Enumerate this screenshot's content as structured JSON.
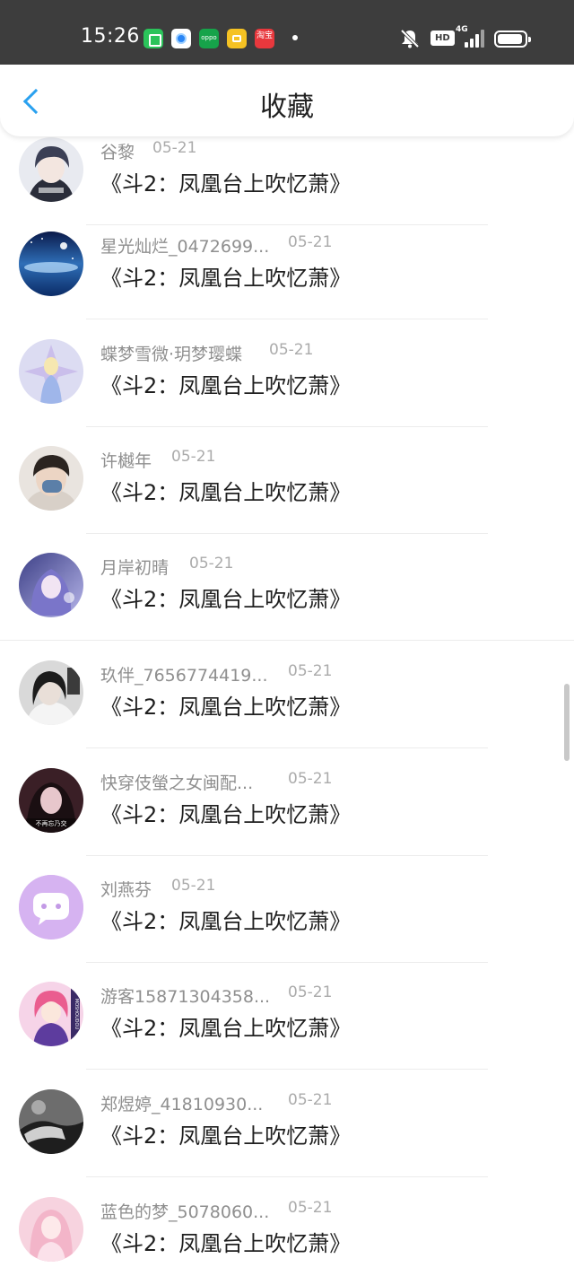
{
  "status_bar": {
    "time": "15:26",
    "apps": [
      "wechat-style-app",
      "circle-app",
      "oppo",
      "diamond-app",
      "淘宝"
    ],
    "oppo_label": "oppo",
    "taobao_label": "淘宝",
    "hd": "HD",
    "network": "4G"
  },
  "header": {
    "title": "收藏",
    "back_icon": "chevron-left-icon",
    "accent": "#2aa1ef"
  },
  "items": [
    {
      "name": "谷黎",
      "date": "05-21",
      "title": "《斗2：凤凰台上吹忆萧》"
    },
    {
      "name": "星光灿烂_0472699...",
      "date": "05-21",
      "title": "《斗2：凤凰台上吹忆萧》"
    },
    {
      "name": "蝶梦雪微·玥梦璎蝶",
      "date": "05-21",
      "title": "《斗2：凤凰台上吹忆萧》"
    },
    {
      "name": "许樾年",
      "date": "05-21",
      "title": "《斗2：凤凰台上吹忆萧》"
    },
    {
      "name": "月岸初晴",
      "date": "05-21",
      "title": "《斗2：凤凰台上吹忆萧》"
    },
    {
      "name": "玖伴_7656774419...",
      "date": "05-21",
      "title": "《斗2：凤凰台上吹忆萧》"
    },
    {
      "name": "快穿伎螢之女闽配...",
      "date": "05-21",
      "title": "《斗2：凤凰台上吹忆萧》"
    },
    {
      "name": "刘燕芬",
      "date": "05-21",
      "title": "《斗2：凤凰台上吹忆萧》"
    },
    {
      "name": "游客15871304358...",
      "date": "05-21",
      "title": "《斗2：凤凰台上吹忆萧》"
    },
    {
      "name": "郑煜婷_41810930...",
      "date": "05-21",
      "title": "《斗2：凤凰台上吹忆萧》"
    },
    {
      "name": "蓝色的梦_5078060...",
      "date": "05-21",
      "title": "《斗2：凤凰台上吹忆萧》"
    }
  ],
  "avatar_texts": {
    "item7": "不再忘乃交",
    "item9": "MOSHOUDOU"
  }
}
